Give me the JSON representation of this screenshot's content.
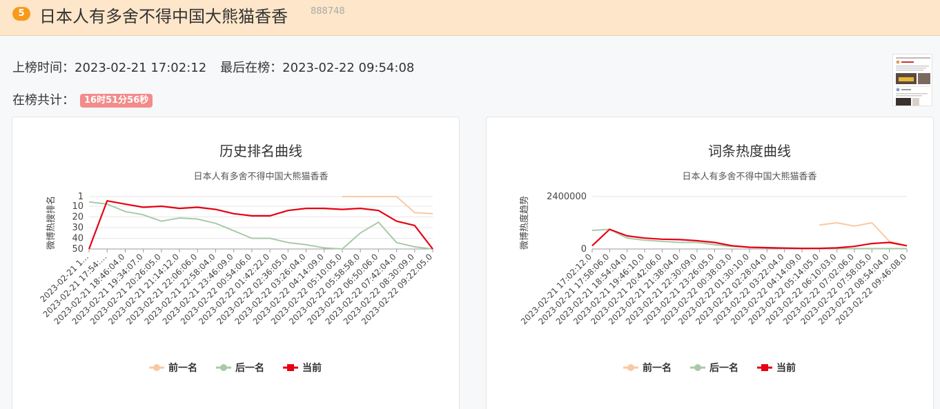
{
  "header": {
    "rank": "5",
    "title": "日本人有多舍不得中国大熊猫香香",
    "count": "888748"
  },
  "info": {
    "on_label": "上榜时间：",
    "on_time": "2023-02-21 17:02:12",
    "last_label": "最后在榜：",
    "last_time": "2023-02-22 09:54:08",
    "total_label": "在榜共计：",
    "total_duration": "16时51分56秒"
  },
  "colors": {
    "prev": "#f9c9a3",
    "next": "#a9c9a8",
    "current": "#e60012"
  },
  "chart_data": [
    {
      "type": "line",
      "title": "历史排名曲线",
      "subtitle": "日本人有多舍不得中国大熊猫香香",
      "xlabel": "",
      "ylabel": "微博热搜排名",
      "y_inverted": true,
      "ylim": [
        1,
        50
      ],
      "yticks": [
        1,
        10,
        20,
        30,
        40,
        50
      ],
      "categories": [
        "2023-02-21 1…",
        "2023-02-21 17:54:…",
        "2023-02-21 18:46:04.0",
        "2023-02-21 19:34:07.0",
        "2023-02-21 20:26:05.0",
        "2023-02-21 21:14:12.0",
        "2023-02-21 22:06:06.0",
        "2023-02-21 22:58:04.0",
        "2023-02-21 23:46:09.0",
        "2023-02-22 00:54:06.0",
        "2023-02-22 01:42:22.0",
        "2023-02-22 02:36:05.0",
        "2023-02-22 03:26:04.0",
        "2023-02-22 04:14:09.0",
        "2023-02-22 05:10:05.0",
        "2023-02-22 05:58:58.0",
        "2023-02-22 06:50:06.0",
        "2023-02-22 07:42:04.0",
        "2023-02-22 08:30:09.0",
        "2023-02-22 09:22:05.0"
      ],
      "legend": [
        "前一名",
        "后一名",
        "当前"
      ],
      "series": [
        {
          "name": "前一名",
          "values": [
            null,
            null,
            null,
            null,
            null,
            null,
            null,
            null,
            null,
            null,
            null,
            null,
            null,
            null,
            1,
            1,
            1,
            1,
            16,
            17
          ]
        },
        {
          "name": "后一名",
          "values": [
            6,
            8,
            15,
            18,
            24,
            21,
            22,
            26,
            33,
            40,
            40,
            44,
            46,
            49,
            50,
            35,
            25,
            44,
            48,
            50
          ]
        },
        {
          "name": "当前",
          "values": [
            50,
            5,
            8,
            11,
            10,
            12,
            11,
            13,
            17,
            19,
            19,
            14,
            12,
            12,
            13,
            12,
            14,
            24,
            28,
            50
          ]
        }
      ]
    },
    {
      "type": "line",
      "title": "词条热度曲线",
      "subtitle": "日本人有多舍不得中国大熊猫香香",
      "xlabel": "",
      "ylabel": "微博热度趋势",
      "ylim": [
        0,
        2400000
      ],
      "yticks": [
        0,
        2400000
      ],
      "categories": [
        "2023-02-21 17:02:12.0",
        "2023-02-21 17:58:06.0",
        "2023-02-21 18:54:04.0",
        "2023-02-21 19:46:10.0",
        "2023-02-21 20:42:06.0",
        "2023-02-21 21:38:04.0",
        "2023-02-21 22:30:09.0",
        "2023-02-21 23:26:05.0",
        "2023-02-22 00:38:03.0",
        "2023-02-22 01:30:10.0",
        "2023-02-22 02:28:04.0",
        "2023-02-22 03:22:04.0",
        "2023-02-22 04:14:09.0",
        "2023-02-22 05:14:05.0",
        "2023-02-22 06:10:03.0",
        "2023-02-22 07:02:06.0",
        "2023-02-22 07:58:05.0",
        "2023-02-22 08:54:04.0",
        "2023-02-22 09:46:08.0"
      ],
      "legend": [
        "前一名",
        "后一名",
        "当前"
      ],
      "series": [
        {
          "name": "前一名",
          "values": [
            null,
            null,
            null,
            null,
            null,
            null,
            null,
            null,
            null,
            null,
            null,
            null,
            null,
            1100000,
            1200000,
            1050000,
            1200000,
            350000,
            150000
          ]
        },
        {
          "name": "后一名",
          "values": [
            850000,
            900000,
            500000,
            400000,
            350000,
            300000,
            300000,
            200000,
            120000,
            80000,
            60000,
            40000,
            30000,
            20000,
            20000,
            20000,
            20000,
            20000,
            20000
          ]
        },
        {
          "name": "当前",
          "values": [
            150000,
            900000,
            600000,
            500000,
            450000,
            430000,
            380000,
            300000,
            150000,
            80000,
            60000,
            40000,
            30000,
            30000,
            50000,
            120000,
            250000,
            300000,
            150000
          ]
        }
      ]
    }
  ]
}
